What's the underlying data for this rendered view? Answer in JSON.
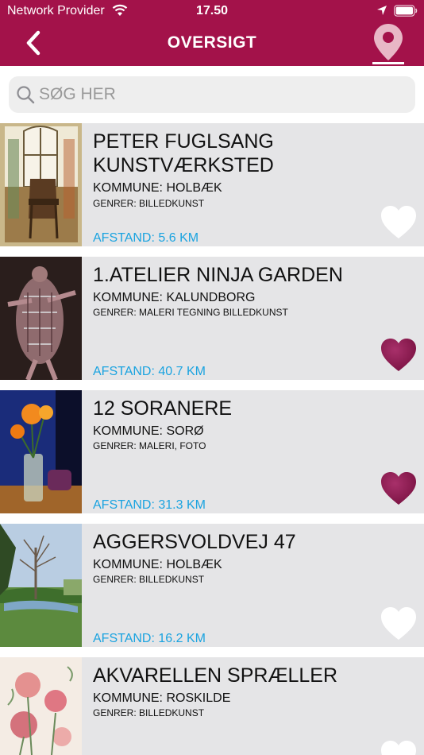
{
  "status_bar": {
    "carrier": "Network Provider",
    "time": "17.50"
  },
  "header": {
    "title": "OVERSIGT",
    "back_icon": "chevron-left-icon",
    "map_icon": "map-pin-icon"
  },
  "search": {
    "placeholder": "SØG HER",
    "value": ""
  },
  "colors": {
    "header": "#a3124a",
    "distance": "#1aa3e0",
    "heart_favorite": "#8c1a4d",
    "heart_default": "#ffffff",
    "row_bg": "#e5e5e7"
  },
  "items": [
    {
      "title": " PETER FUGLSANG KUNSTVÆRKSTED",
      "kommune": "KOMMUNE: HOLBÆK",
      "genrer": "GENRER: BILLEDKUNST",
      "distance": "AFSTAND: 5.6 KM",
      "favorite": false
    },
    {
      "title": "1.ATELIER NINJA GARDEN",
      "kommune": "KOMMUNE: KALUNDBORG",
      "genrer": "GENRER: MALERI TEGNING BILLEDKUNST",
      "distance": "AFSTAND: 40.7 KM",
      "favorite": true
    },
    {
      "title": "12 SORANERE",
      "kommune": "KOMMUNE: SORØ",
      "genrer": "GENRER: MALERI, FOTO",
      "distance": "AFSTAND: 31.3 KM",
      "favorite": true
    },
    {
      "title": "AGGERSVOLDVEJ 47",
      "kommune": "KOMMUNE: HOLBÆK",
      "genrer": "GENRER: BILLEDKUNST",
      "distance": "AFSTAND: 16.2 KM",
      "favorite": false
    },
    {
      "title": "AKVARELLEN SPRÆLLER",
      "kommune": "KOMMUNE: ROSKILDE",
      "genrer": "GENRER: BILLEDKUNST",
      "distance": "",
      "favorite": false
    }
  ]
}
